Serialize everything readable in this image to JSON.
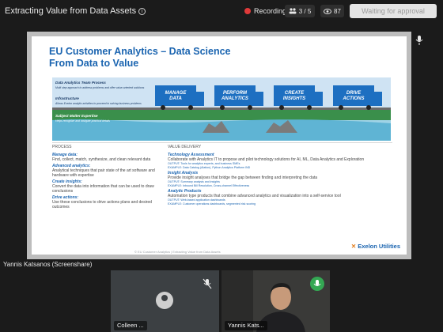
{
  "meeting": {
    "title": "Extracting Value from Data Assets",
    "recording_label": "Recording",
    "participants_count": "3 / 5",
    "viewers_count": "87",
    "approval_button": "Waiting for approval"
  },
  "slide": {
    "title": "EU Customer Analytics – Data Science\nFrom Data to Value",
    "layers": {
      "team_process_title": "Data Analytics Team Process",
      "team_process_text": "Multi step approach to address problems and offer value-oriented solutions",
      "infrastructure_title": "Infrastructure",
      "infrastructure_text": "Allows Exelon analytic activities to proceed in solving business problems",
      "sme_title": "Subject Matter Expertise",
      "sme_text": "Helps recognize and navigate practical details"
    },
    "trucks": [
      "MANAGE DATA",
      "PERFORM ANALYTICS",
      "CREATE INSIGHTS",
      "DRIVE ACTIONS"
    ],
    "process": {
      "heading": "PROCESS",
      "items": [
        {
          "title": "Manage data:",
          "text": "Find, collect, match, synthesize, and clean relevant data"
        },
        {
          "title": "Advanced analytics:",
          "text": "Analytical techniques that pair state of the art software and hardware with expertise"
        },
        {
          "title": "Create insights:",
          "text": "Convert the data into information that can be used to draw conclusions"
        },
        {
          "title": "Drive actions:",
          "text": "Use these conclusions to drive actions plans and desired outcomes"
        }
      ]
    },
    "value": {
      "heading": "VALUE DELIVERY",
      "items": [
        {
          "title": "Technology Assessment",
          "text": "Collaborate with Analytics IT to propose and pilot technology solutions for AI, ML, Data Analytics and Exploration",
          "output": "OUTPUT: Tools for analytics experts, and business SMEs",
          "example": "EXAMPLE: Data Catalog (Alation), Python Analytics Platform IND"
        },
        {
          "title": "Insight Analysis",
          "text": "Provide insight analyses that bridge the gap between finding and interpreting the data",
          "output": "OUTPUT: Summary analysis and insights",
          "example": "EXAMPLE: Inbound Bill Resolution, Cross-channel Effectiveness"
        },
        {
          "title": "Analytic Products",
          "text": "Automation type products that combine advanced analytics and visualization into a self-service tool",
          "output": "OUTPUT: Web-based application dashboards",
          "example": "EXAMPLE: Customer operations dashboards, segmented risk scoring"
        }
      ]
    },
    "footer": "© EU Customer Analytics | Extracting Value from Data Assets",
    "logo_text": "Exelon Utilities",
    "colors": {
      "accent": "#1a64b0",
      "truck": "#1d6fc1",
      "ground": "#2e8b3e"
    }
  },
  "presenter_label": "Yannis Katsanos (Screenshare)",
  "tiles": [
    {
      "name": "Colleen ...",
      "mic": "muted"
    },
    {
      "name": "Yannis Kats...",
      "mic": "speaking"
    }
  ],
  "icons": {
    "info": "info-icon",
    "record": "record-dot-icon",
    "people": "people-icon",
    "eye": "eye-icon",
    "pin": "pin-icon",
    "mic_off": "mic-off-icon",
    "speaking": "speaking-icon",
    "avatar": "avatar-icon"
  }
}
